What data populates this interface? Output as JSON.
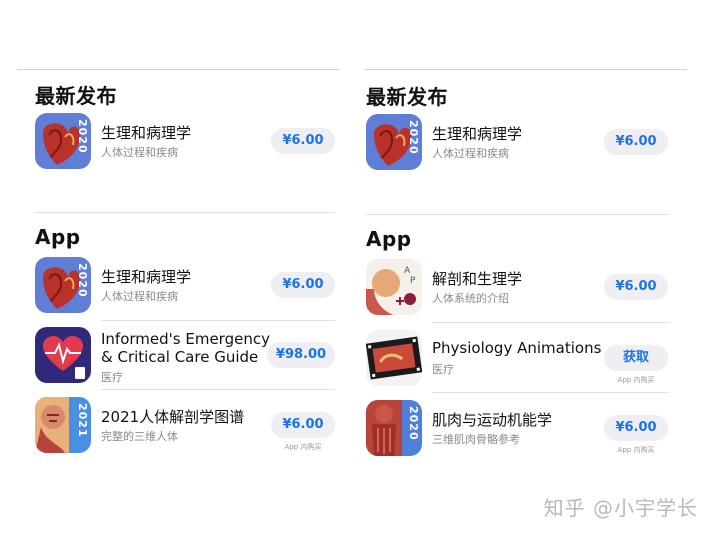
{
  "left": {
    "new_release": {
      "title": "最新发布",
      "app": {
        "name": "生理和病理学",
        "subtitle": "人体过程和疾病",
        "price": "¥6.00",
        "year": "2020"
      }
    },
    "apps_section": {
      "title": "App",
      "apps": [
        {
          "name": "生理和病理学",
          "subtitle": "人体过程和疾病",
          "price": "¥6.00",
          "year": "2020"
        },
        {
          "name_line1": "Informed's Emergency",
          "name_line2": "& Critical Care Guide",
          "subtitle": "医疗",
          "price": "¥98.00"
        },
        {
          "name": "2021人体解剖学图谱",
          "subtitle": "完整的三维人体",
          "price": "¥6.00",
          "iap": "App 内购买",
          "year": "2021"
        }
      ]
    }
  },
  "right": {
    "new_release": {
      "title": "最新发布",
      "app": {
        "name": "生理和病理学",
        "subtitle": "人体过程和疾病",
        "price": "¥6.00",
        "year": "2020"
      }
    },
    "apps_section": {
      "title": "App",
      "apps": [
        {
          "name": "解剖和生理学",
          "subtitle": "人体系统的介绍",
          "price": "¥6.00"
        },
        {
          "name": "Physiology Animations",
          "subtitle": "医疗",
          "price": "获取",
          "iap": "App 内购买"
        },
        {
          "name": "肌肉与运动机能学",
          "subtitle": "三维肌肉骨骼参考",
          "price": "¥6.00",
          "iap": "App 内购买",
          "year": "2020"
        }
      ]
    }
  },
  "watermark": "知乎 @小宇学长",
  "colors": {
    "accent": "#1a73e8",
    "button_bg": "#eeeef3",
    "secondary_text": "#8a8a8e"
  },
  "icons": [
    "heart-anatomy-icon",
    "ekg-heart-icon",
    "anatomy-head-icon",
    "ap-anatomy-icon",
    "film-strip-icon",
    "muscle-anatomy-icon"
  ]
}
